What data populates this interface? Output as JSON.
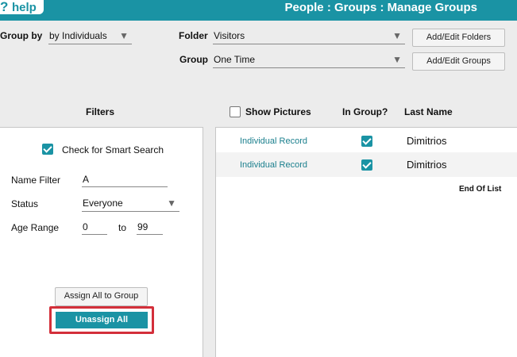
{
  "header": {
    "help_label": "help",
    "title": "People : Groups : Manage Groups"
  },
  "toolbar": {
    "group_by_label": "Group by",
    "group_by_value": "by Individuals",
    "folder_label": "Folder",
    "folder_value": "Visitors",
    "add_edit_folders": "Add/Edit Folders",
    "group_label": "Group",
    "group_value": "One Time",
    "add_edit_groups": "Add/Edit Groups"
  },
  "filters": {
    "heading": "Filters",
    "smart_search_label": "Check for Smart Search",
    "smart_search_checked": true,
    "name_filter_label": "Name Filter",
    "name_filter_value": "A",
    "status_label": "Status",
    "status_value": "Everyone",
    "age_range_label": "Age Range",
    "age_from": "0",
    "age_to_label": "to",
    "age_to": "99",
    "assign_all_label": "Assign All to Group",
    "unassign_all_label": "Unassign All"
  },
  "results": {
    "show_pictures_label": "Show Pictures",
    "show_pictures_checked": false,
    "col_in_group": "In Group?",
    "col_last_name": "Last Name",
    "rows": [
      {
        "link": "Individual Record",
        "in_group": true,
        "last_name": "Dimitrios"
      },
      {
        "link": "Individual Record",
        "in_group": true,
        "last_name": "Dimitrios"
      }
    ],
    "end_of_list": "End Of List"
  },
  "colors": {
    "accent": "#1a93a4",
    "highlight_border": "#d32f3a"
  }
}
